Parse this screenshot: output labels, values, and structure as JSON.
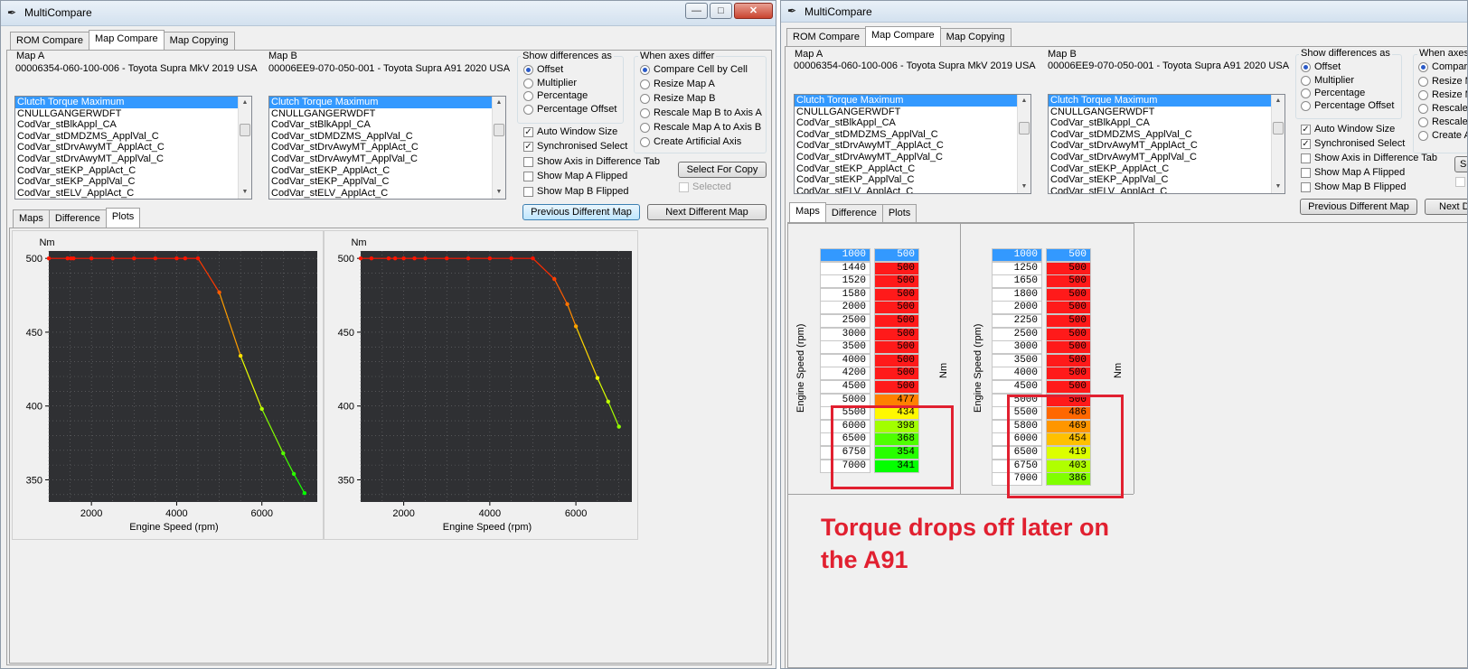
{
  "left_window": {
    "title": "MultiCompare",
    "top_tabs": [
      "ROM Compare",
      "Map Compare",
      "Map Copying"
    ],
    "active_top_tab": 1,
    "map_a": {
      "label": "Map A",
      "rom": "00006354-060-100-006 - Toyota Supra MkV 2019 USA"
    },
    "map_b": {
      "label": "Map B",
      "rom": "00006EE9-070-050-001 - Toyota Supra A91 2020 USA"
    },
    "list_items": [
      "Clutch Torque Maximum",
      "CNULLGANGERWDFT",
      "CodVar_stBlkAppl_CA",
      "CodVar_stDMDZMS_ApplVal_C",
      "CodVar_stDrvAwyMT_ApplAct_C",
      "CodVar_stDrvAwyMT_ApplVal_C",
      "CodVar_stEKP_ApplAct_C",
      "CodVar_stEKP_ApplVal_C",
      "CodVar_stELV_ApplAct_C"
    ],
    "show_diff_title": "Show differences as",
    "show_diff_options": [
      "Offset",
      "Multiplier",
      "Percentage",
      "Percentage Offset"
    ],
    "show_diff_selected": 0,
    "axes_title": "When axes differ",
    "axes_options": [
      "Compare Cell by Cell",
      "Resize Map A",
      "Resize Map B",
      "Rescale Map B to Axis A",
      "Rescale Map A to Axis B",
      "Create Artificial Axis"
    ],
    "axes_selected": 0,
    "checkboxes": [
      {
        "label": "Auto Window Size",
        "checked": true
      },
      {
        "label": "Synchronised Select",
        "checked": true
      },
      {
        "label": "Show Axis in Difference Tab",
        "checked": false
      },
      {
        "label": "Show Map A Flipped",
        "checked": false
      },
      {
        "label": "Show Map B Flipped",
        "checked": false
      }
    ],
    "select_for_copy": "Select For Copy",
    "selected_label": "Selected",
    "prev_button": "Previous Different Map",
    "next_button": "Next Different Map",
    "sub_tabs": [
      "Maps",
      "Difference",
      "Plots"
    ],
    "active_sub_tab": 2
  },
  "right_window": {
    "title": "MultiCompare",
    "top_tabs": [
      "ROM Compare",
      "Map Compare",
      "Map Copying"
    ],
    "active_top_tab": 1,
    "map_a": {
      "label": "Map A",
      "rom": "00006354-060-100-006 - Toyota Supra MkV 2019 USA"
    },
    "map_b": {
      "label": "Map B",
      "rom": "00006EE9-070-050-001 - Toyota Supra A91 2020 USA"
    },
    "list_items": [
      "Clutch Torque Maximum",
      "CNULLGANGERWDFT",
      "CodVar_stBlkAppl_CA",
      "CodVar_stDMDZMS_ApplVal_C",
      "CodVar_stDrvAwyMT_ApplAct_C",
      "CodVar_stDrvAwyMT_ApplVal_C",
      "CodVar_stEKP_ApplAct_C",
      "CodVar_stEKP_ApplVal_C",
      "CodVar_stELV_ApplAct_C"
    ],
    "show_diff_title": "Show differences as",
    "show_diff_options": [
      "Offset",
      "Multiplier",
      "Percentage",
      "Percentage Offset"
    ],
    "show_diff_selected": 0,
    "axes_title": "When axes d",
    "axes_options": [
      "Compare",
      "Resize M",
      "Resize M",
      "Rescale N",
      "Rescale N",
      "Create A"
    ],
    "axes_selected": 0,
    "checkboxes": [
      {
        "label": "Auto Window Size",
        "checked": true
      },
      {
        "label": "Synchronised Select",
        "checked": true
      },
      {
        "label": "Show Axis in Difference Tab",
        "checked": false
      },
      {
        "label": "Show Map A Flipped",
        "checked": false
      },
      {
        "label": "Show Map B Flipped",
        "checked": false
      }
    ],
    "select_for_copy": "Se",
    "prev_button": "Previous Different Map",
    "next_button": "Next Di",
    "sub_tabs": [
      "Maps",
      "Difference",
      "Plots"
    ],
    "active_sub_tab": 0,
    "axis_label": "Engine Speed (rpm)",
    "unit_label": "Nm",
    "map_a_table": {
      "rpm": [
        1000,
        1440,
        1520,
        1580,
        2000,
        2500,
        3000,
        3500,
        4000,
        4200,
        4500,
        5000,
        5500,
        6000,
        6500,
        6750,
        7000
      ],
      "nm": [
        500,
        500,
        500,
        500,
        500,
        500,
        500,
        500,
        500,
        500,
        500,
        477,
        434,
        398,
        368,
        354,
        341
      ]
    },
    "map_b_table": {
      "rpm": [
        1000,
        1250,
        1650,
        1800,
        2000,
        2250,
        2500,
        3000,
        3500,
        4000,
        4500,
        5000,
        5500,
        5800,
        6000,
        6500,
        6750,
        7000
      ],
      "nm": [
        500,
        500,
        500,
        500,
        500,
        500,
        500,
        500,
        500,
        500,
        500,
        500,
        486,
        469,
        454,
        419,
        403,
        386
      ]
    },
    "annotation": [
      "Torque drops off later on",
      "the A91"
    ]
  },
  "chart_data": [
    {
      "type": "line",
      "title": "",
      "xlabel": "Engine Speed (rpm)",
      "ylabel": "Nm",
      "xlim": [
        1000,
        7300
      ],
      "ylim": [
        335,
        505
      ],
      "xticks": [
        2000,
        4000,
        6000
      ],
      "yticks": [
        350,
        400,
        450,
        500
      ],
      "grid": true,
      "x": [
        1000,
        1440,
        1520,
        1580,
        2000,
        2500,
        3000,
        3500,
        4000,
        4200,
        4500,
        5000,
        5500,
        6000,
        6500,
        6750,
        7000
      ],
      "y": [
        500,
        500,
        500,
        500,
        500,
        500,
        500,
        500,
        500,
        500,
        500,
        477,
        434,
        398,
        368,
        354,
        341
      ]
    },
    {
      "type": "line",
      "title": "",
      "xlabel": "Engine Speed (rpm)",
      "ylabel": "Nm",
      "xlim": [
        1000,
        7300
      ],
      "ylim": [
        335,
        505
      ],
      "xticks": [
        2000,
        4000,
        6000
      ],
      "yticks": [
        350,
        400,
        450,
        500
      ],
      "grid": true,
      "x": [
        1000,
        1250,
        1650,
        1800,
        2000,
        2250,
        2500,
        3000,
        3500,
        4000,
        4500,
        5000,
        5500,
        5800,
        6000,
        6500,
        6750,
        7000
      ],
      "y": [
        500,
        500,
        500,
        500,
        500,
        500,
        500,
        500,
        500,
        500,
        500,
        500,
        486,
        469,
        454,
        419,
        403,
        386
      ]
    }
  ]
}
